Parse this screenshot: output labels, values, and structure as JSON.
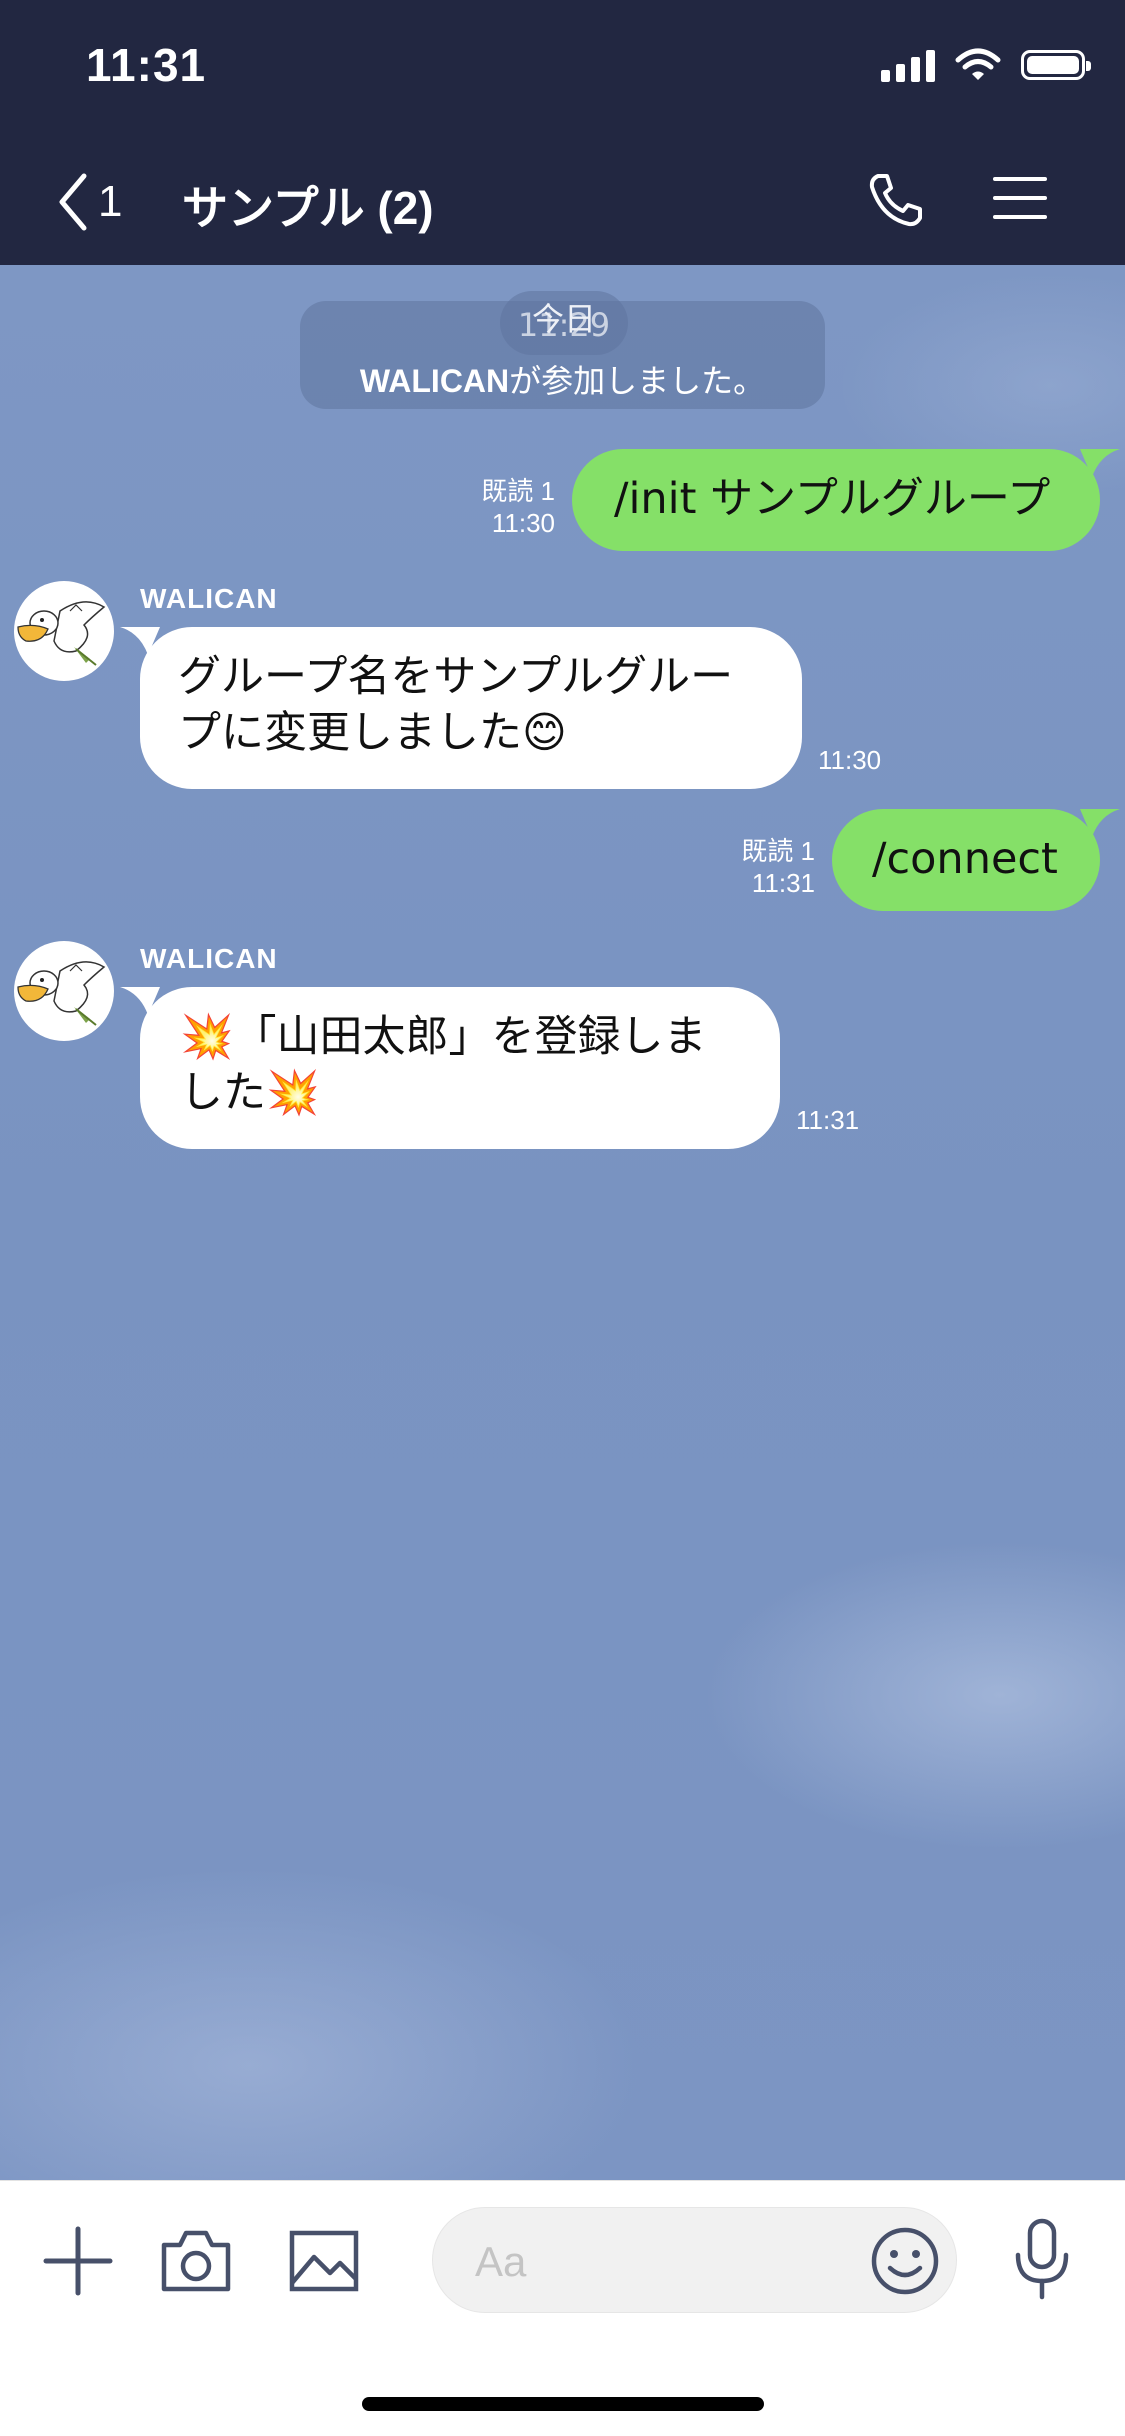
{
  "status_bar": {
    "time": "11:31"
  },
  "header": {
    "back_count": "1",
    "title": "サンプル (2)"
  },
  "system": {
    "date_label": "今日",
    "time_label": "11:29",
    "join_name": "WALICAN",
    "join_text": "が参加しました。"
  },
  "messages": [
    {
      "text": "/init サンプルグループ",
      "read": "既読 1",
      "time": "11:30"
    },
    {
      "sender": "WALICAN",
      "line1": "グループ名をサンプルグルー",
      "line2": "プに変更しました",
      "emoji": "😊",
      "time": "11:30"
    },
    {
      "text": "/connect",
      "read": "既読 1",
      "time": "11:31"
    },
    {
      "sender": "WALICAN",
      "line1": "「山田太郎」を登録しま",
      "line2": "した",
      "emoji": "💥",
      "time": "11:31"
    }
  ],
  "input": {
    "placeholder": "Aa"
  },
  "icons": [
    "chevron-left-icon",
    "phone-icon",
    "menu-icon",
    "plus-icon",
    "camera-icon",
    "image-icon",
    "emoji-icon",
    "microphone-icon"
  ],
  "colors": {
    "header_bg": "#222741",
    "chat_bg": "#7b94c2",
    "outgoing_bubble": "#85e068",
    "incoming_bubble": "#ffffff"
  }
}
